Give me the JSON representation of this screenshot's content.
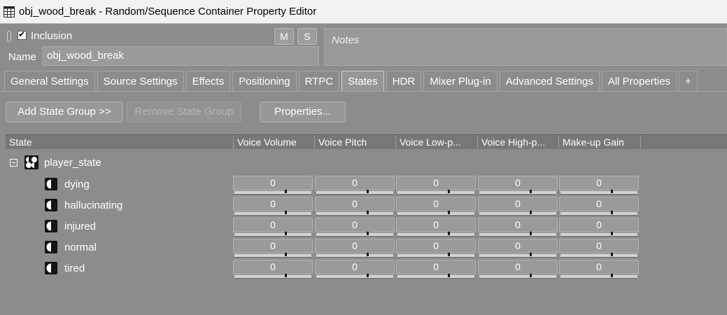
{
  "window": {
    "title": "obj_wood_break - Random/Sequence Container Property Editor"
  },
  "header": {
    "inclusion_label": "Inclusion",
    "inclusion_checked": true,
    "m_label": "M",
    "s_label": "S",
    "name_label": "Name",
    "name_value": "obj_wood_break",
    "notes_placeholder": "Notes"
  },
  "tabs": [
    {
      "label": "General Settings"
    },
    {
      "label": "Source Settings"
    },
    {
      "label": "Effects"
    },
    {
      "label": "Positioning"
    },
    {
      "label": "RTPC"
    },
    {
      "label": "States",
      "active": true
    },
    {
      "label": "HDR"
    },
    {
      "label": "Mixer Plug-in"
    },
    {
      "label": "Advanced Settings"
    },
    {
      "label": "All Properties"
    },
    {
      "label": "+"
    }
  ],
  "toolbar": {
    "add_state_group": "Add State Group >>",
    "remove_state_group": "Remove State Group",
    "properties": "Properties..."
  },
  "grid": {
    "columns": [
      "State",
      "Voice Volume",
      "Voice Pitch",
      "Voice Low-p...",
      "Voice High-p...",
      "Make-up Gain"
    ],
    "group": "player_state",
    "rows": [
      {
        "state": "dying",
        "values": [
          "0",
          "0",
          "0",
          "0",
          "0"
        ]
      },
      {
        "state": "hallucinating",
        "values": [
          "0",
          "0",
          "0",
          "0",
          "0"
        ]
      },
      {
        "state": "injured",
        "values": [
          "0",
          "0",
          "0",
          "0",
          "0"
        ]
      },
      {
        "state": "normal",
        "values": [
          "0",
          "0",
          "0",
          "0",
          "0"
        ]
      },
      {
        "state": "tired",
        "values": [
          "0",
          "0",
          "0",
          "0",
          "0"
        ]
      }
    ]
  },
  "icons": {
    "app": "grid-icon",
    "group": "state-group-icon",
    "state": "state-icon"
  }
}
